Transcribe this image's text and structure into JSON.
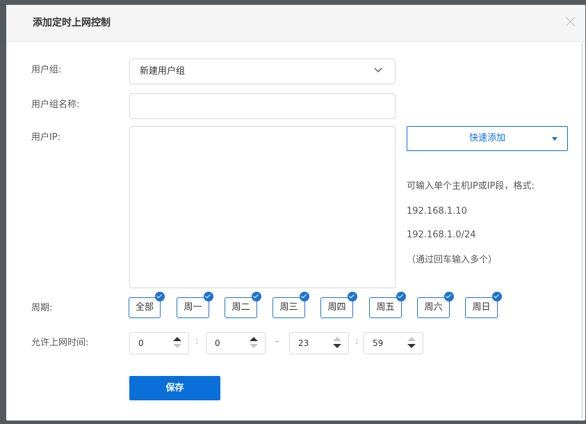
{
  "dialog": {
    "title": "添加定时上网控制"
  },
  "form": {
    "user_group": {
      "label": "用户组:",
      "value": "新建用户组"
    },
    "group_name": {
      "label": "用户组名称:",
      "value": ""
    },
    "user_ip": {
      "label": "用户IP:",
      "value": ""
    },
    "quick_add": {
      "label": "快速添加"
    },
    "hint": {
      "line1": "可输入单个主机IP或IP段，格式:",
      "line2": "192.168.1.10",
      "line3": "192.168.1.0/24",
      "line4": "（通过回车输入多个）"
    },
    "period": {
      "label": "周期:",
      "days": [
        {
          "label": "全部",
          "checked": true
        },
        {
          "label": "周一",
          "checked": true
        },
        {
          "label": "周二",
          "checked": true
        },
        {
          "label": "周三",
          "checked": true
        },
        {
          "label": "周四",
          "checked": true
        },
        {
          "label": "周五",
          "checked": true
        },
        {
          "label": "周六",
          "checked": true
        },
        {
          "label": "周日",
          "checked": true
        }
      ]
    },
    "time": {
      "label": "允许上网时间:",
      "start_hour": "0",
      "start_minute": "0",
      "end_hour": "23",
      "end_minute": "59",
      "colon": ":",
      "dash": "-"
    },
    "save_label": "保存"
  },
  "colors": {
    "accent": "#0a6fd8",
    "overlay": "#555a5e"
  }
}
